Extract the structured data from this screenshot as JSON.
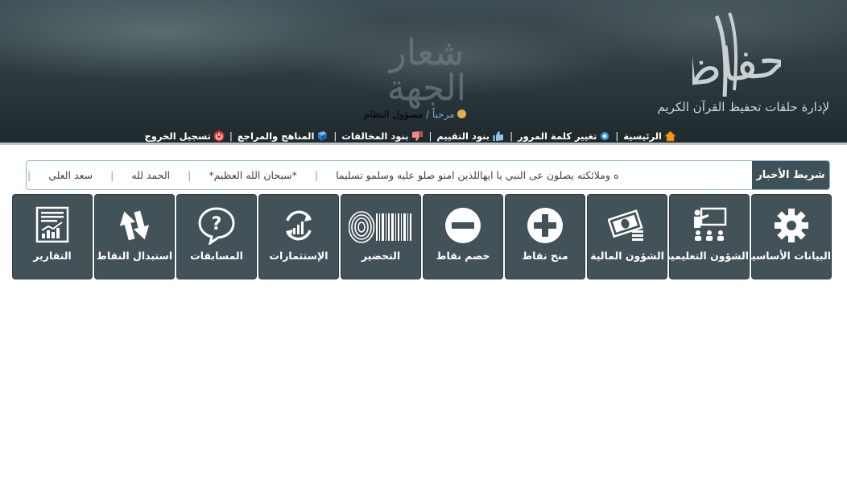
{
  "header": {
    "logo_text": "حفاظ",
    "slogan": "شعار الجهة",
    "subtitle": "لإدارة حلقات تحفيظ القرآن الكريم",
    "welcome": {
      "greeting": "مرحباً /",
      "user": "مسؤول النظام"
    }
  },
  "nav": {
    "items": [
      {
        "label": "الرئيسية",
        "icon": "home-icon",
        "color": "#f39a1b"
      },
      {
        "label": "تغيير كلمة المرور",
        "icon": "gear-icon",
        "color": "#3aa0e6"
      },
      {
        "label": "بنود التقييم",
        "icon": "thumbs-up-icon",
        "color": "#5aa7e0"
      },
      {
        "label": "بنود المخالفات",
        "icon": "thumbs-down-icon",
        "color": "#e04848"
      },
      {
        "label": "المناهج والمراجع",
        "icon": "book-icon",
        "color": "#2f7fc9"
      },
      {
        "label": "تسجيل الخروج",
        "icon": "power-icon",
        "color": "#e03030"
      }
    ],
    "separator": "|"
  },
  "ticker": {
    "label": "شريط الأخبار",
    "items": [
      "سعد العلي",
      "الحمد لله",
      "*سبحان الله العظيم*",
      "ه وملائكته يصلون عى النبي يا ايهاللذين امنو صلو عليه وسلمو تسليما"
    ],
    "separator": "|"
  },
  "tiles": [
    {
      "label": "البيانات الأساسية",
      "icon": "gear-icon"
    },
    {
      "label": "الشؤون التعليمية",
      "icon": "teacher-board-icon"
    },
    {
      "label": "الشؤون المالية",
      "icon": "money-icon"
    },
    {
      "label": "منح نقاط",
      "icon": "plus-circle-icon"
    },
    {
      "label": "خصم نقاط",
      "icon": "minus-circle-icon"
    },
    {
      "label": "التحضير",
      "icon": "fingerprint-barcode-icon"
    },
    {
      "label": "الإستثمارات",
      "icon": "recycle-chart-icon"
    },
    {
      "label": "المسابقات",
      "icon": "question-bubble-icon"
    },
    {
      "label": "استبدال النقاط",
      "icon": "exchange-arrows-icon"
    },
    {
      "label": "التقارير",
      "icon": "report-chart-icon"
    }
  ],
  "colors": {
    "header_bg": "#2c393e",
    "tile_bg": "#435258",
    "ticker_label_bg": "#3e5158",
    "ticker_border": "#8fb7d4"
  }
}
